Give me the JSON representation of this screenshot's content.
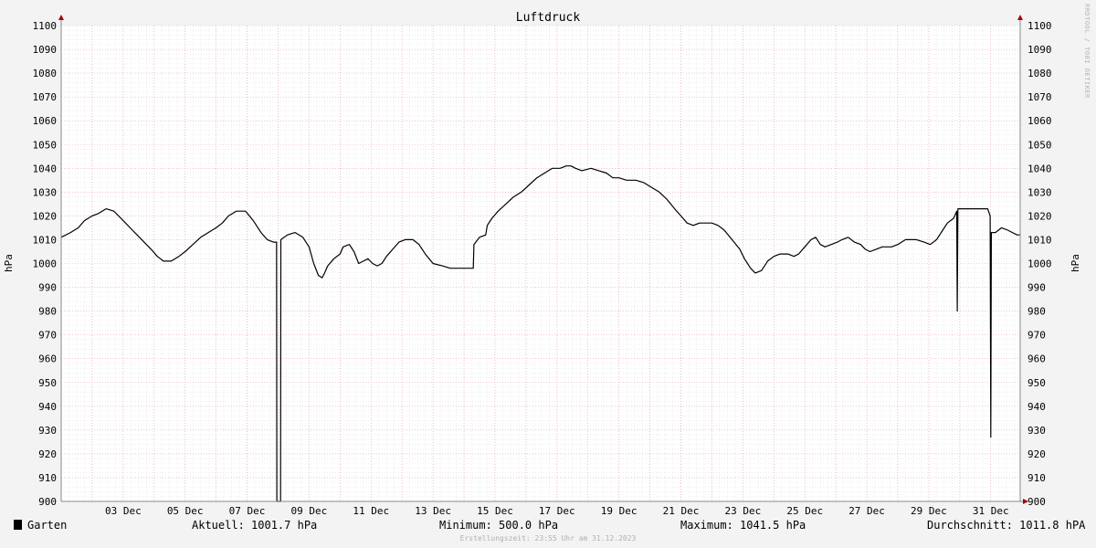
{
  "chart_data": {
    "type": "line",
    "title": "Luftdruck",
    "ylabel_left": "hPa",
    "ylabel_right": "hPa",
    "ylim": [
      900,
      1100
    ],
    "y_ticks": [
      900,
      910,
      920,
      930,
      940,
      950,
      960,
      970,
      980,
      990,
      1000,
      1010,
      1020,
      1030,
      1040,
      1050,
      1060,
      1070,
      1080,
      1090,
      1100
    ],
    "x_axis": "time, 1–31 Dec 2023 (days)",
    "xlim": [
      1.0,
      31.95
    ],
    "x_ticks": [
      {
        "x": 3,
        "label": "03 Dec"
      },
      {
        "x": 5,
        "label": "05 Dec"
      },
      {
        "x": 7,
        "label": "07 Dec"
      },
      {
        "x": 9,
        "label": "09 Dec"
      },
      {
        "x": 11,
        "label": "11 Dec"
      },
      {
        "x": 13,
        "label": "13 Dec"
      },
      {
        "x": 15,
        "label": "15 Dec"
      },
      {
        "x": 17,
        "label": "17 Dec"
      },
      {
        "x": 19,
        "label": "19 Dec"
      },
      {
        "x": 21,
        "label": "21 Dec"
      },
      {
        "x": 23,
        "label": "23 Dec"
      },
      {
        "x": 25,
        "label": "25 Dec"
      },
      {
        "x": 27,
        "label": "27 Dec"
      },
      {
        "x": 29,
        "label": "29 Dec"
      },
      {
        "x": 31,
        "label": "31 Dec"
      }
    ],
    "grid": true,
    "series": [
      {
        "name": "Garten",
        "color": "#000000",
        "points": [
          [
            1.0,
            1011
          ],
          [
            1.3,
            1013
          ],
          [
            1.55,
            1015
          ],
          [
            1.75,
            1018
          ],
          [
            2.0,
            1020
          ],
          [
            2.2,
            1021
          ],
          [
            2.45,
            1023
          ],
          [
            2.7,
            1022
          ],
          [
            3.0,
            1018
          ],
          [
            3.3,
            1014
          ],
          [
            3.6,
            1010
          ],
          [
            3.9,
            1006
          ],
          [
            4.1,
            1003
          ],
          [
            4.3,
            1001
          ],
          [
            4.55,
            1001
          ],
          [
            4.8,
            1003
          ],
          [
            5.0,
            1005
          ],
          [
            5.25,
            1008
          ],
          [
            5.5,
            1011
          ],
          [
            5.75,
            1013
          ],
          [
            6.0,
            1015
          ],
          [
            6.2,
            1017
          ],
          [
            6.4,
            1020
          ],
          [
            6.65,
            1022
          ],
          [
            6.95,
            1022
          ],
          [
            7.2,
            1018
          ],
          [
            7.45,
            1013
          ],
          [
            7.65,
            1010
          ],
          [
            7.85,
            1009
          ],
          [
            7.95,
            1009
          ],
          [
            7.96,
            900
          ],
          [
            8.08,
            900
          ],
          [
            8.09,
            1010
          ],
          [
            8.3,
            1012
          ],
          [
            8.55,
            1013
          ],
          [
            8.8,
            1011
          ],
          [
            9.0,
            1007
          ],
          [
            9.15,
            1000
          ],
          [
            9.3,
            995
          ],
          [
            9.42,
            994
          ],
          [
            9.5,
            996
          ],
          [
            9.6,
            999
          ],
          [
            9.8,
            1002
          ],
          [
            10.0,
            1004
          ],
          [
            10.1,
            1007
          ],
          [
            10.3,
            1008
          ],
          [
            10.45,
            1005
          ],
          [
            10.6,
            1000
          ],
          [
            10.75,
            1001
          ],
          [
            10.9,
            1002
          ],
          [
            11.05,
            1000
          ],
          [
            11.2,
            999
          ],
          [
            11.35,
            1000
          ],
          [
            11.5,
            1003
          ],
          [
            11.7,
            1006
          ],
          [
            11.9,
            1009
          ],
          [
            12.1,
            1010
          ],
          [
            12.35,
            1010
          ],
          [
            12.55,
            1008
          ],
          [
            12.75,
            1004
          ],
          [
            13.0,
            1000
          ],
          [
            13.3,
            999
          ],
          [
            13.55,
            998
          ],
          [
            13.8,
            998
          ],
          [
            14.3,
            998
          ],
          [
            14.32,
            1008
          ],
          [
            14.5,
            1011
          ],
          [
            14.7,
            1012
          ],
          [
            14.75,
            1016
          ],
          [
            14.9,
            1019
          ],
          [
            15.1,
            1022
          ],
          [
            15.35,
            1025
          ],
          [
            15.6,
            1028
          ],
          [
            15.85,
            1030
          ],
          [
            16.1,
            1033
          ],
          [
            16.35,
            1036
          ],
          [
            16.6,
            1038
          ],
          [
            16.85,
            1040
          ],
          [
            17.1,
            1040
          ],
          [
            17.3,
            1041
          ],
          [
            17.45,
            1041
          ],
          [
            17.6,
            1040
          ],
          [
            17.8,
            1039
          ],
          [
            18.1,
            1040
          ],
          [
            18.35,
            1039
          ],
          [
            18.6,
            1038
          ],
          [
            18.8,
            1036
          ],
          [
            19.0,
            1036
          ],
          [
            19.25,
            1035
          ],
          [
            19.55,
            1035
          ],
          [
            19.8,
            1034
          ],
          [
            20.05,
            1032
          ],
          [
            20.3,
            1030
          ],
          [
            20.55,
            1027
          ],
          [
            20.8,
            1023
          ],
          [
            21.0,
            1020
          ],
          [
            21.2,
            1017
          ],
          [
            21.4,
            1016
          ],
          [
            21.6,
            1017
          ],
          [
            22.0,
            1017
          ],
          [
            22.2,
            1016
          ],
          [
            22.4,
            1014
          ],
          [
            22.65,
            1010
          ],
          [
            22.9,
            1006
          ],
          [
            23.05,
            1002
          ],
          [
            23.25,
            998
          ],
          [
            23.4,
            996
          ],
          [
            23.6,
            997
          ],
          [
            23.8,
            1001
          ],
          [
            24.0,
            1003
          ],
          [
            24.2,
            1004
          ],
          [
            24.45,
            1004
          ],
          [
            24.65,
            1003
          ],
          [
            24.8,
            1004
          ],
          [
            25.0,
            1007
          ],
          [
            25.2,
            1010
          ],
          [
            25.35,
            1011
          ],
          [
            25.5,
            1008
          ],
          [
            25.65,
            1007
          ],
          [
            25.85,
            1008
          ],
          [
            26.05,
            1009
          ],
          [
            26.2,
            1010
          ],
          [
            26.4,
            1011
          ],
          [
            26.6,
            1009
          ],
          [
            26.8,
            1008
          ],
          [
            26.95,
            1006
          ],
          [
            27.1,
            1005
          ],
          [
            27.3,
            1006
          ],
          [
            27.5,
            1007
          ],
          [
            27.8,
            1007
          ],
          [
            28.0,
            1008
          ],
          [
            28.25,
            1010
          ],
          [
            28.6,
            1010
          ],
          [
            28.85,
            1009
          ],
          [
            29.05,
            1008
          ],
          [
            29.25,
            1010
          ],
          [
            29.45,
            1014
          ],
          [
            29.6,
            1017
          ],
          [
            29.8,
            1019
          ],
          [
            29.9,
            1022
          ],
          [
            29.92,
            980
          ],
          [
            29.94,
            1023
          ],
          [
            30.2,
            1023
          ],
          [
            30.5,
            1023
          ],
          [
            30.9,
            1023
          ],
          [
            30.98,
            1020
          ],
          [
            31.0,
            927
          ],
          [
            31.02,
            1013
          ],
          [
            31.15,
            1013
          ],
          [
            31.35,
            1015
          ],
          [
            31.55,
            1014
          ],
          [
            31.7,
            1013
          ],
          [
            31.85,
            1012
          ],
          [
            31.95,
            1012
          ]
        ]
      }
    ]
  },
  "legend": {
    "series_label": "Garten",
    "current": "Aktuell: 1001.7 hPa",
    "minimum": "Minimum: 500.0 hPa",
    "maximum": "Maximum: 1041.5 hPa",
    "average": "Durchschnitt: 1011.8 hPA"
  },
  "footer": "Erstellungszeit: 23:55 Uhr am 31.12.2023",
  "watermark": "RRDTOOL / TOBI OETIKER"
}
